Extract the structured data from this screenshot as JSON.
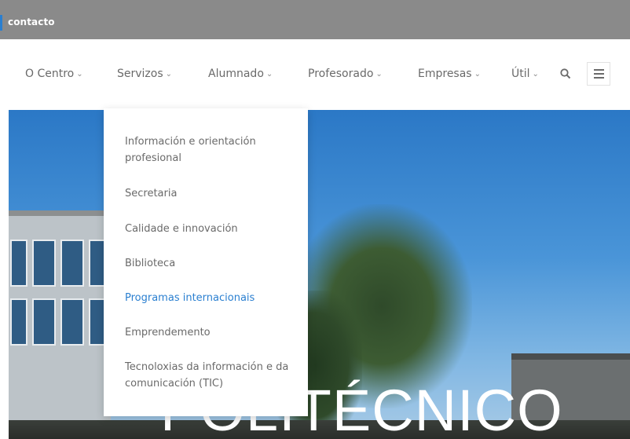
{
  "topbar": {
    "contact_label": "contacto"
  },
  "nav": {
    "items": [
      {
        "label": "O Centro"
      },
      {
        "label": "Servizos"
      },
      {
        "label": "Alumnado"
      },
      {
        "label": "Profesorado"
      },
      {
        "label": "Empresas"
      },
      {
        "label": "Útil"
      }
    ],
    "chevron": "⌄"
  },
  "dropdown": {
    "items": [
      {
        "label": "Información e orientación profesional"
      },
      {
        "label": "Secretaria"
      },
      {
        "label": "Calidade e innovación"
      },
      {
        "label": "Biblioteca"
      },
      {
        "label": "Programas internacionais",
        "active": true
      },
      {
        "label": "Emprendemento"
      },
      {
        "label": "Tecnoloxias da información e da comunicación (TIC)"
      }
    ]
  },
  "hero": {
    "title": "POLITÉCNICO"
  },
  "colors": {
    "topbar": "#8a8a8a",
    "accent": "#2a7fd0",
    "nav_text": "#6a6a6a"
  },
  "icons": [
    "search-icon",
    "hamburger-menu-icon",
    "chevron-down-icon"
  ]
}
